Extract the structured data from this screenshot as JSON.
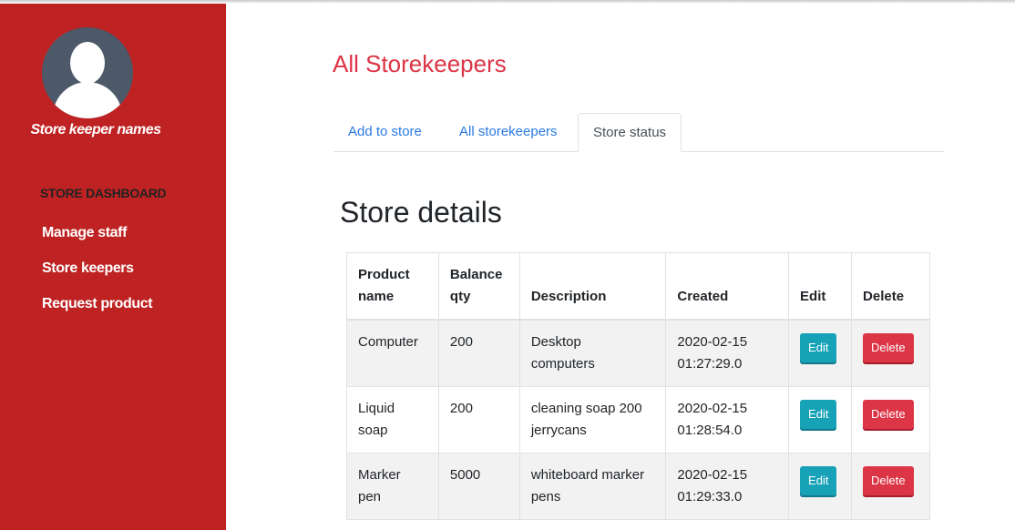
{
  "sidebar": {
    "user_name": "Store keeper names",
    "dashboard_title": "STORE DASHBOARD",
    "links": [
      "Manage staff",
      "Store keepers",
      "Request product"
    ]
  },
  "main": {
    "heading": "All Storekeepers",
    "tabs": [
      {
        "label": "Add to store",
        "active": false
      },
      {
        "label": "All storekeepers",
        "active": false
      },
      {
        "label": "Store status",
        "active": true
      }
    ],
    "section_title": "Store details",
    "table": {
      "headers": {
        "product_line1": "Product",
        "product_line2": "name",
        "balance_line1": "Balance",
        "balance_line2": "qty",
        "description": "Description",
        "created": "Created",
        "edit": "Edit",
        "delete": "Delete"
      },
      "rows": [
        {
          "product_line1": "Computer",
          "product_line2": "",
          "balance": "200",
          "description_line1": "Desktop",
          "description_line2": "computers",
          "created_date": "2020-02-15",
          "created_time": "01:27:29.0",
          "edit_label": "Edit",
          "delete_label": "Delete"
        },
        {
          "product_line1": "Liquid",
          "product_line2": "soap",
          "balance": "200",
          "description_line1": "cleaning soap 200",
          "description_line2": "jerrycans",
          "created_date": "2020-02-15",
          "created_time": "01:28:54.0",
          "edit_label": "Edit",
          "delete_label": "Delete"
        },
        {
          "product_line1": "Marker",
          "product_line2": "pen",
          "balance": "5000",
          "description_line1": "whiteboard marker",
          "description_line2": "pens",
          "created_date": "2020-02-15",
          "created_time": "01:29:33.0",
          "edit_label": "Edit",
          "delete_label": "Delete"
        }
      ]
    }
  },
  "colors": {
    "sidebar_bg": "#bf2222",
    "heading": "#dc3545",
    "tab_link": "#2a7ae2",
    "edit_button": "#17a2b8",
    "delete_button": "#dc3545",
    "avatar_bg": "#4d5968"
  },
  "icons": {
    "avatar": "user-silhouette-icon"
  }
}
